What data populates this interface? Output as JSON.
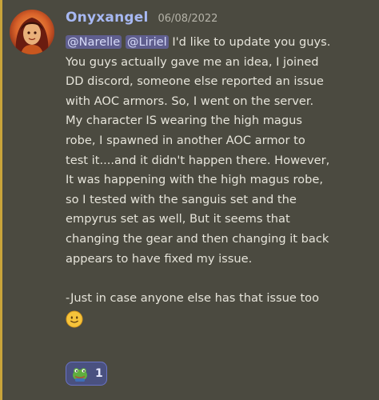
{
  "message": {
    "author": "Onyxangel",
    "timestamp": "06/08/2022",
    "mentions": [
      "@Narelle",
      "@Liriel"
    ],
    "body_lines": [
      " I'd like to update you guys.",
      "You guys actually gave me an idea, I joined",
      "DD discord, someone else reported an issue",
      "with AOC armors. So, I went on the server.",
      "My character IS wearing the high magus",
      "robe, I spawned in another AOC armor to",
      "test it....and it didn't happen there. However,",
      "It was happening with the high magus robe,",
      "so I tested with the sanguis set and the",
      "empyrus set as well, But it seems that",
      "changing the gear and then changing it back",
      "appears to have fixed my issue."
    ],
    "closing_line": "-Just in case anyone else has that issue too",
    "closing_emoji": "slightly-smiling-face-icon"
  },
  "reaction": {
    "emoji": "frog-emoji-icon",
    "count": "1"
  },
  "colors": {
    "background": "#4b4a40",
    "username": "#a7b8f2",
    "mention_bg": "#5f5e8e",
    "reaction_bg": "#4a5180",
    "accent": "#c9a43a"
  }
}
